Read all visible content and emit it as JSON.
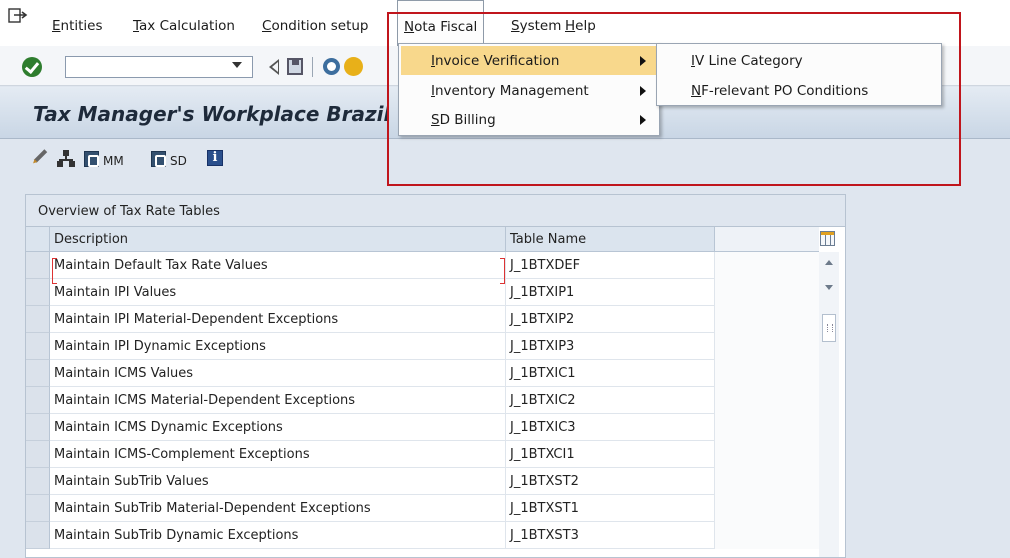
{
  "menubar": {
    "items": [
      {
        "id": "entities",
        "label": "Entities",
        "mnemonic": "E"
      },
      {
        "id": "tax",
        "label": "Tax Calculation",
        "mnemonic": "T"
      },
      {
        "id": "cond",
        "label": "Condition setup",
        "mnemonic": "C"
      },
      {
        "id": "nf",
        "label": "Nota Fiscal",
        "mnemonic": "N"
      },
      {
        "id": "system",
        "label": "System",
        "mnemonic": "S"
      },
      {
        "id": "help",
        "label": "Help",
        "mnemonic": "H"
      }
    ],
    "icons": [
      "menu-entry-icon"
    ]
  },
  "toolbar": {
    "command_field": {
      "value": "",
      "placeholder": ""
    },
    "icons": [
      "ok-icon",
      "dropdown-arrow-icon",
      "back-icon",
      "save-icon",
      "cancel-icon",
      "exit-icon"
    ]
  },
  "title": {
    "text": "Tax Manager's Workplace Brazil"
  },
  "app_toolbar": {
    "buttons": [
      {
        "id": "edit",
        "icon": "pencil-icon",
        "label": ""
      },
      {
        "id": "hier",
        "icon": "hierarchy-icon",
        "label": ""
      },
      {
        "id": "mm",
        "icon": "selection-icon",
        "label": "MM"
      },
      {
        "id": "sd",
        "icon": "selection-icon",
        "label": "SD"
      },
      {
        "id": "info",
        "icon": "info-icon",
        "label": "i"
      }
    ]
  },
  "table": {
    "caption": "Overview of Tax Rate Tables",
    "columns": [
      "Description",
      "Table Name"
    ],
    "rows": [
      {
        "description": "Maintain Default Tax Rate Values",
        "table_name": "J_1BTXDEF"
      },
      {
        "description": "Maintain IPI Values",
        "table_name": "J_1BTXIP1"
      },
      {
        "description": "Maintain IPI Material-Dependent Exceptions",
        "table_name": "J_1BTXIP2"
      },
      {
        "description": "Maintain IPI Dynamic Exceptions",
        "table_name": "J_1BTXIP3"
      },
      {
        "description": "Maintain ICMS Values",
        "table_name": "J_1BTXIC1"
      },
      {
        "description": "Maintain ICMS Material-Dependent Exceptions",
        "table_name": "J_1BTXIC2"
      },
      {
        "description": "Maintain ICMS Dynamic Exceptions",
        "table_name": "J_1BTXIC3"
      },
      {
        "description": "Maintain ICMS-Complement Exceptions",
        "table_name": "J_1BTXCI1"
      },
      {
        "description": "Maintain SubTrib Values",
        "table_name": "J_1BTXST2"
      },
      {
        "description": "Maintain SubTrib Material-Dependent Exceptions",
        "table_name": "J_1BTXST1"
      },
      {
        "description": "Maintain SubTrib Dynamic Exceptions",
        "table_name": "J_1BTXST3"
      }
    ]
  },
  "nota_fiscal_menu": {
    "items": [
      {
        "label": "Invoice Verification",
        "mnemonic": "I",
        "highlighted": true,
        "has_submenu": true
      },
      {
        "label": "Inventory Management",
        "mnemonic": "I",
        "highlighted": false,
        "has_submenu": true
      },
      {
        "label": "SD Billing",
        "mnemonic": "S",
        "highlighted": false,
        "has_submenu": true
      }
    ]
  },
  "invoice_verification_submenu": {
    "items": [
      {
        "label": "IV Line Category",
        "mnemonic": "I"
      },
      {
        "label": "NF-relevant PO Conditions",
        "mnemonic": "N"
      }
    ]
  },
  "colors": {
    "menu_highlight": "#f8d88c",
    "annotation_red": "#c0151c",
    "title_gradient_top": "#e4ebf3",
    "title_gradient_bottom": "#c9d6e5"
  }
}
